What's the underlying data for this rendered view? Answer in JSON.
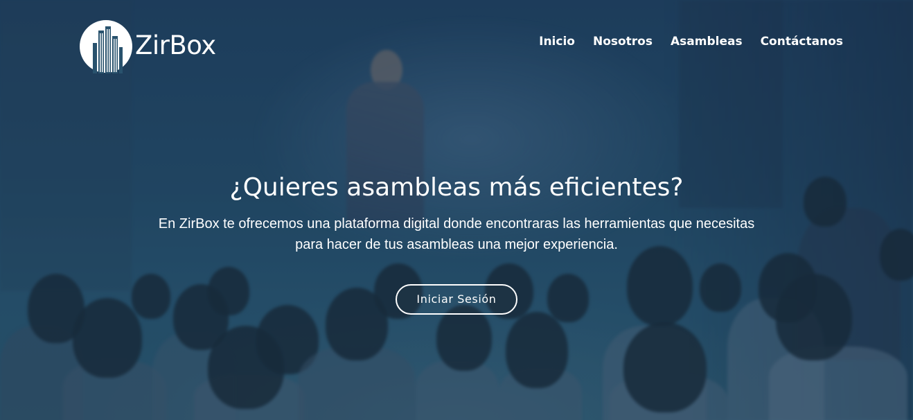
{
  "brand": {
    "name": "ZirBox",
    "logo_icon": "city-buildings-circle-icon"
  },
  "nav": {
    "items": [
      {
        "label": "Inicio"
      },
      {
        "label": "Nosotros"
      },
      {
        "label": "Asambleas"
      },
      {
        "label": "Contáctanos"
      }
    ]
  },
  "hero": {
    "title": "¿Quieres asambleas más eficientes?",
    "subtitle_line1": "En ZirBox te ofrecemos una plataforma digital donde encontraras las herramientas que necesitas",
    "subtitle_line2": "para hacer de tus asambleas una mejor experiencia.",
    "cta_label": "Iniciar Sesión",
    "background": "conference-audience-photo"
  },
  "colors": {
    "overlay": "#244a66",
    "text": "#ffffff"
  }
}
